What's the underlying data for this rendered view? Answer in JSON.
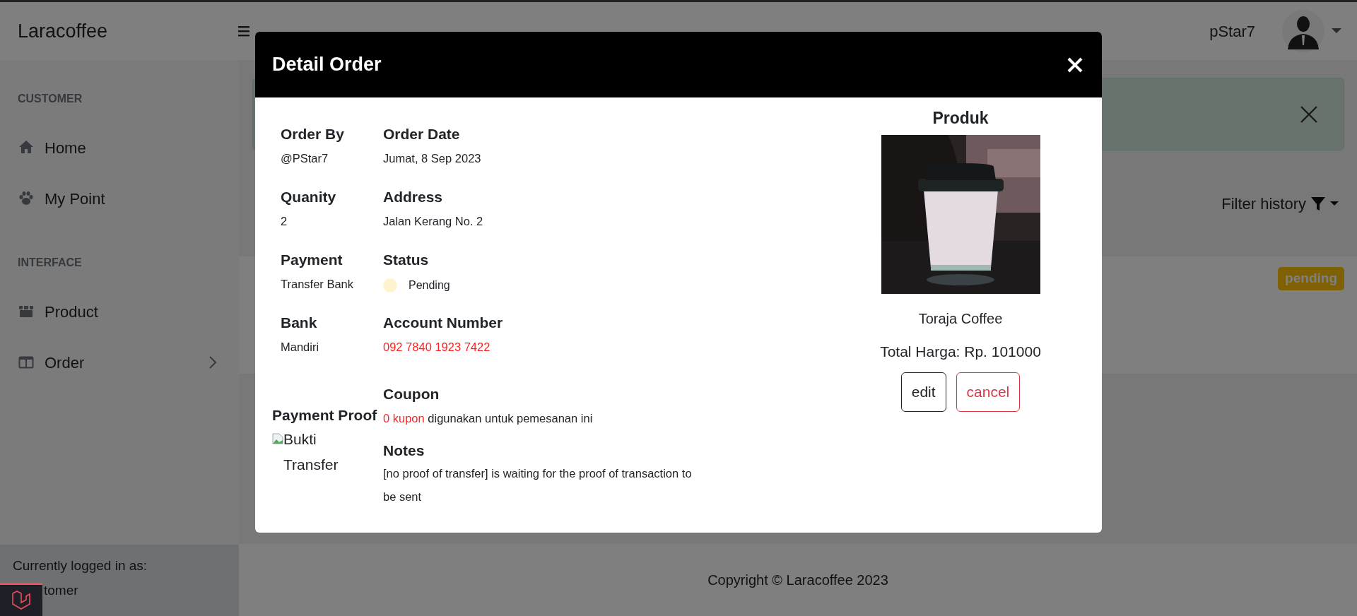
{
  "navbar": {
    "brand": "Laracoffee",
    "user": "pStar7"
  },
  "sidebar": {
    "sections": [
      {
        "heading": "CUSTOMER",
        "items": [
          {
            "label": "Home",
            "kind": "link"
          },
          {
            "label": "My Point",
            "kind": "link"
          }
        ]
      },
      {
        "heading": "INTERFACE",
        "items": [
          {
            "label": "Product",
            "kind": "link"
          },
          {
            "label": "Order",
            "kind": "collapse"
          }
        ]
      }
    ],
    "footer": {
      "caption": "Currently logged in as:",
      "user": "tomer"
    }
  },
  "main": {
    "filter": "Filter history",
    "badge": "pending",
    "footer": "Copyright © Laracoffee 2023"
  },
  "modal": {
    "title": "Detail Order",
    "fields_left": [
      {
        "label": "Order By",
        "value": "@PStar7"
      },
      {
        "label": "Quanity",
        "value": "2"
      },
      {
        "label": "Payment",
        "value": "Transfer Bank"
      },
      {
        "label": "Bank",
        "value": "Mandiri"
      }
    ],
    "fields_right": [
      {
        "label": "Order Date",
        "value": "Jumat, 8 Sep 2023",
        "kind": "text"
      },
      {
        "label": "Address",
        "value": "Jalan Kerang No. 2",
        "kind": "text"
      },
      {
        "label": "Status",
        "value": "Pending",
        "kind": "status",
        "color": "#fff3cd"
      },
      {
        "label": "Account Number",
        "value": "092 7840 1923 7422",
        "kind": "highlight"
      }
    ],
    "payment_proof": {
      "label": "Payment Proof",
      "alt": "Bukti Transfer"
    },
    "coupon": {
      "label": "Coupon",
      "count": "0 kupon",
      "text": "digunakan untuk pemesanan ini"
    },
    "notes": {
      "label": "Notes",
      "text": "[no proof of transfer] is waiting for the proof of transaction to be sent"
    },
    "product": {
      "heading": "Produk",
      "name": "Toraja Coffee",
      "total": "Total Harga: Rp. 101000",
      "buttons": [
        {
          "label": "edit",
          "kind": "edit"
        },
        {
          "label": "cancel",
          "kind": "cancel"
        }
      ]
    }
  }
}
